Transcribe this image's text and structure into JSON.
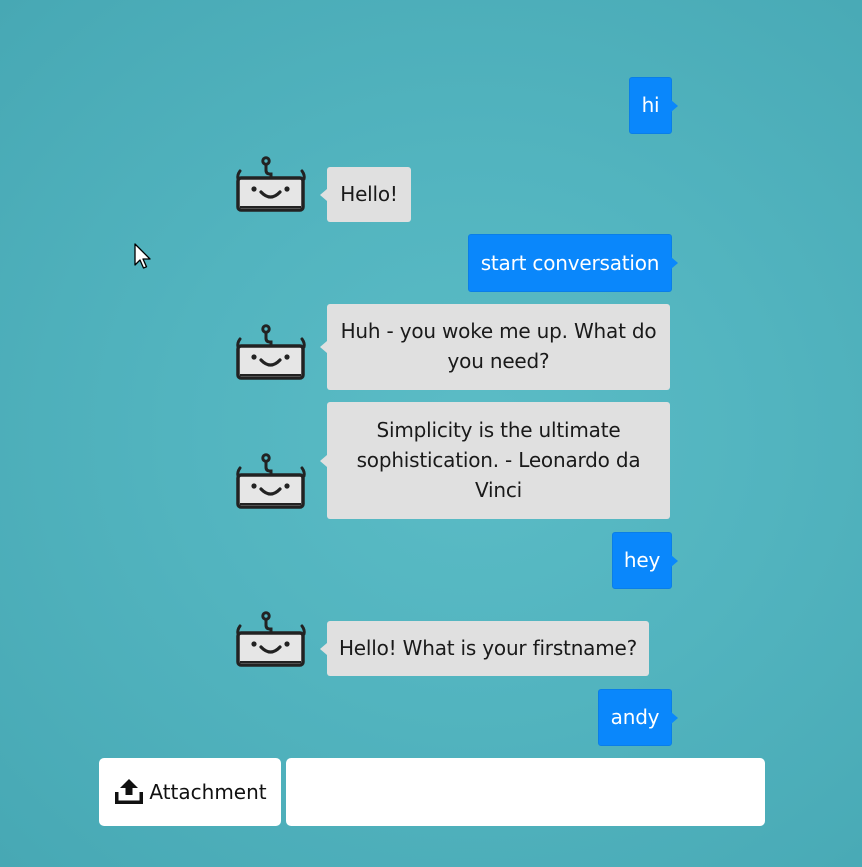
{
  "conversation": {
    "messages": [
      {
        "sender": "user",
        "text": "hi"
      },
      {
        "sender": "bot",
        "text": "Hello!"
      },
      {
        "sender": "user",
        "text": "start conversation"
      },
      {
        "sender": "bot",
        "text": "Huh - you woke me up. What do you need?"
      },
      {
        "sender": "bot",
        "text": "Simplicity is the ultimate sophistication. - Leonardo da Vinci"
      },
      {
        "sender": "user",
        "text": "hey"
      },
      {
        "sender": "bot",
        "text": "Hello! What is your firstname?"
      },
      {
        "sender": "user",
        "text": "andy"
      }
    ]
  },
  "composer": {
    "attachment_label": "Attachment",
    "attachment_icon": "upload-tray-icon",
    "input_value": "",
    "input_placeholder": ""
  },
  "icons": {
    "bot_avatar": "robot-face-icon",
    "pointer": "mouse-pointer-icon"
  },
  "colors": {
    "user_bubble": "#0a87fb",
    "bot_bubble": "#e0e0e0",
    "background": "#52b4bf"
  }
}
